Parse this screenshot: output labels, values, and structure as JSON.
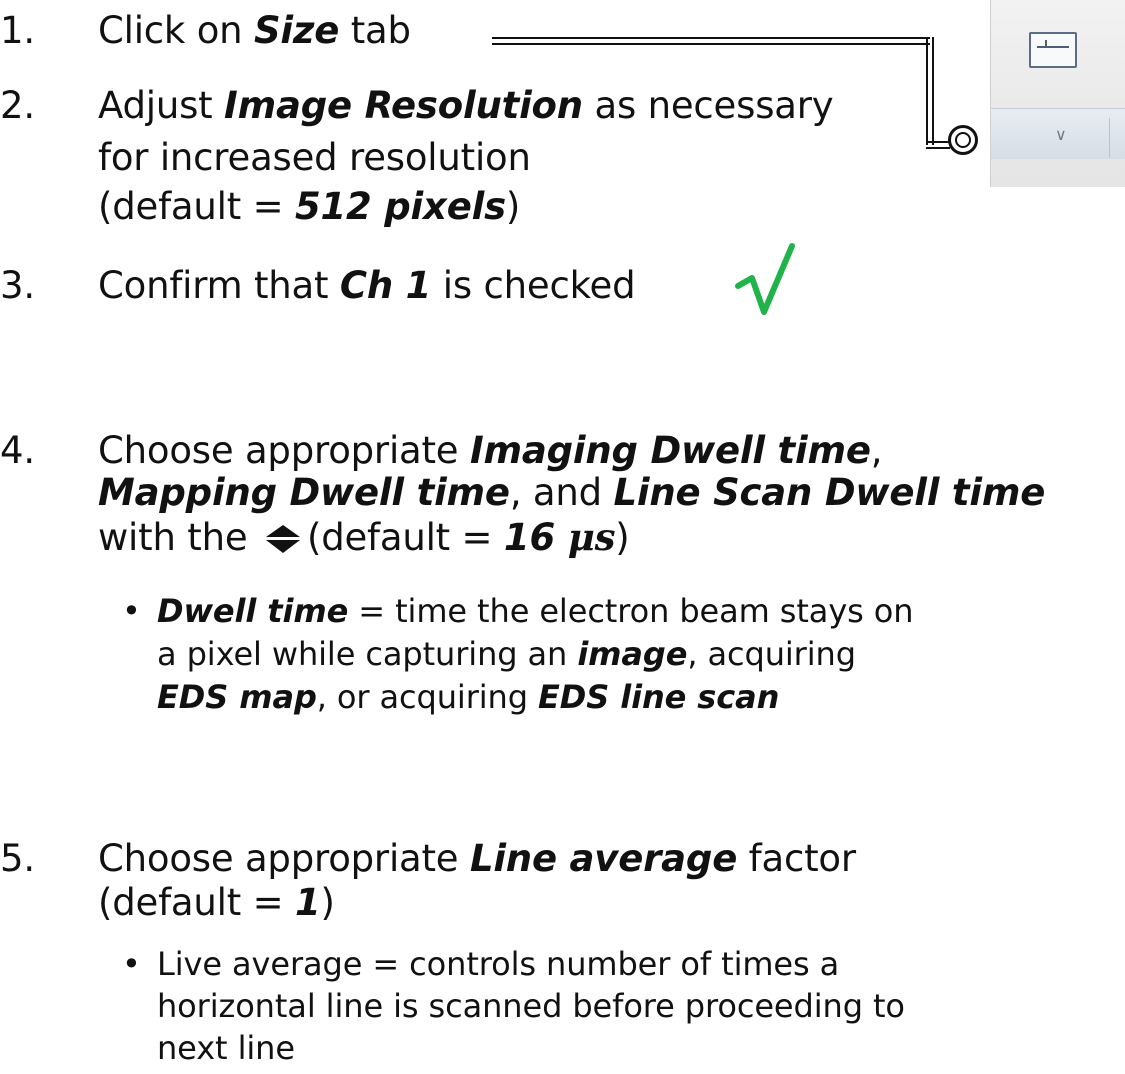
{
  "steps": [
    {
      "num": "1.",
      "parts": [
        "Click on ",
        "Size",
        " tab"
      ]
    },
    {
      "num": "2.",
      "parts": [
        "Adjust ",
        "Image Resolution",
        " as necessary"
      ],
      "line2": "for increased resolution",
      "line3": [
        "(default = ",
        "512 pixels",
        ")"
      ]
    },
    {
      "num": "3.",
      "parts": [
        "Confirm that ",
        "Ch 1",
        " is checked"
      ]
    },
    {
      "num": "4.",
      "parts": [
        "Choose appropriate ",
        "Imaging Dwell time",
        ","
      ],
      "line2": [
        "Mapping Dwell time",
        ", and ",
        "Line Scan Dwell time"
      ],
      "line3": [
        "with the ",
        "(default = ",
        "16 ",
        "μs",
        ")"
      ],
      "sub": {
        "line1": [
          "Dwell time",
          " = time the electron beam stays on"
        ],
        "line2": [
          "a pixel while capturing an ",
          "image",
          ", acquiring"
        ],
        "line3": [
          "EDS map",
          ", or acquiring ",
          "EDS line scan"
        ]
      }
    },
    {
      "num": "5.",
      "parts": [
        "Choose appropriate ",
        "Line average",
        " factor"
      ],
      "line2": [
        "(default = ",
        "1",
        ")"
      ],
      "sub": {
        "line1": "Live average = controls number of times a",
        "line2": "horizontal line is scanned before proceeding to",
        "line3": "next line"
      }
    }
  ],
  "icons": {
    "checkmark": "checkmark-icon",
    "updown": "up-down-arrows-icon",
    "toolbar": "size-tab-icon",
    "chevron": "chevron-down-icon"
  },
  "colors": {
    "checkmark": "#1fb34a",
    "text": "#111111"
  }
}
